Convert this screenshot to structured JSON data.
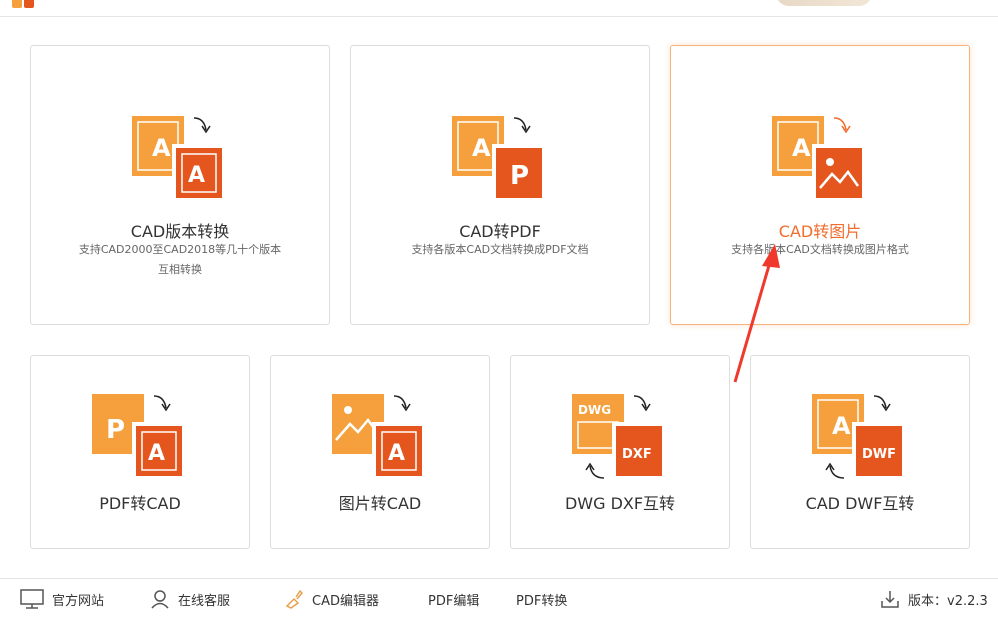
{
  "colors": {
    "accent": "#f26c2c",
    "orange_light": "#f5a03c",
    "orange_dark": "#e4561e",
    "arrow_red": "#f0382c"
  },
  "cards": {
    "cad_version": {
      "title": "CAD版本转换",
      "desc_line1": "支持CAD2000至CAD2018等几十个版本",
      "desc_line2": "互相转换",
      "icon": "cad-version-icon"
    },
    "cad_pdf": {
      "title": "CAD转PDF",
      "desc": "支持各版本CAD文档转换成PDF文档",
      "icon": "cad-to-pdf-icon"
    },
    "cad_image": {
      "title": "CAD转图片",
      "desc": "支持各版本CAD文档转换成图片格式",
      "icon": "cad-to-image-icon",
      "selected": true
    },
    "pdf_cad": {
      "title": "PDF转CAD",
      "icon": "pdf-to-cad-icon"
    },
    "image_cad": {
      "title": "图片转CAD",
      "icon": "image-to-cad-icon"
    },
    "dwg_dxf": {
      "title": "DWG DXF互转",
      "icon": "dwg-dxf-icon",
      "badge_a": "DWG",
      "badge_b": "DXF"
    },
    "cad_dwf": {
      "title": "CAD DWF互转",
      "icon": "cad-dwf-icon",
      "badge_b": "DWF"
    }
  },
  "icon_letters": {
    "a": "A",
    "p": "P"
  },
  "bottom": {
    "website": "官方网站",
    "support": "在线客服",
    "cad_editor": "CAD编辑器",
    "pdf_editor": "PDF编辑",
    "pdf_convert": "PDF转换",
    "version": "版本：v2.2.3"
  }
}
